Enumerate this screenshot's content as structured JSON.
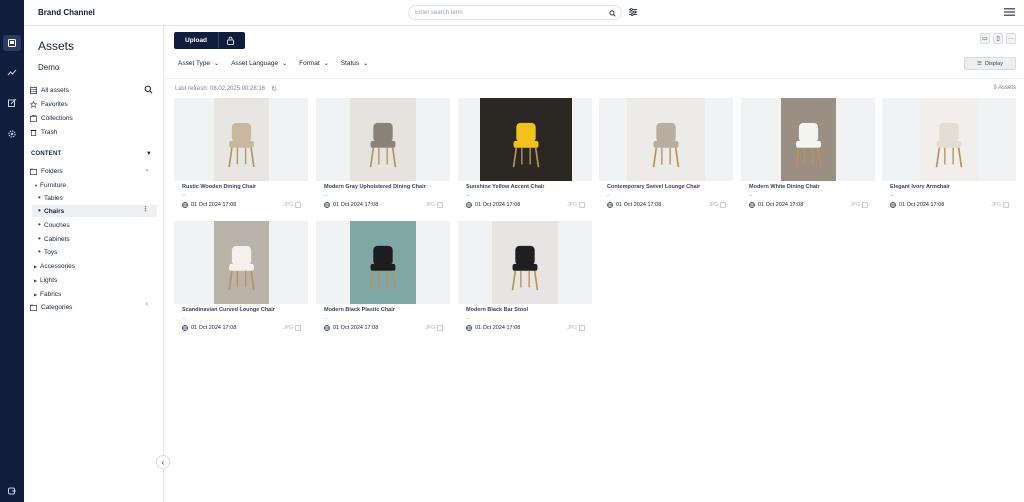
{
  "app": {
    "brand": "Brand Channel"
  },
  "search": {
    "placeholder": "Enter search term"
  },
  "sidebar": {
    "title": "Assets",
    "subtitle": "Demo",
    "nav": [
      {
        "label": "All assets",
        "icon": "grid-icon"
      },
      {
        "label": "Favorites",
        "icon": "star-icon"
      },
      {
        "label": "Collections",
        "icon": "folder-icon"
      },
      {
        "label": "Trash",
        "icon": "trash-icon"
      }
    ],
    "section_label": "CONTENT",
    "tree": {
      "folders": "Folders",
      "furniture": "Furniture",
      "tables": "Tables",
      "chairs": "Chairs",
      "couches": "Couches",
      "cabinets": "Cabinets",
      "toys": "Toys",
      "accessories": "Accessories",
      "lights": "Lights",
      "fabrics": "Fabrics",
      "categories": "Categories"
    }
  },
  "toolbar": {
    "upload_label": "Upload",
    "filters": [
      "Asset Type",
      "Asset Language",
      "Format",
      "Status"
    ],
    "display_label": "Display",
    "last_refresh": "Last refresh: 08.02.2025 00:28:16",
    "asset_count": "9 Assets"
  },
  "colors": {
    "primary": "#101d3d",
    "background": "#ffffff",
    "card_bg": "#f1f2f4"
  },
  "assets": [
    {
      "title": "Rustic Wooden Dining Chair",
      "dash": "--",
      "date": "01 Oct 2024 17:08",
      "format": "JPG",
      "image": {
        "bg": "#e8e6e2",
        "accent": "#c9b8a0"
      }
    },
    {
      "title": "Modern Gray Upholstered Dining Chair",
      "dash": "--",
      "date": "01 Oct 2024 17:08",
      "format": "JPG",
      "image": {
        "bg": "#e4e3de",
        "accent": "#8a8478"
      }
    },
    {
      "title": "Sunshine Yellow Accent Chair",
      "dash": "--",
      "date": "01 Oct 2024 17:08",
      "format": "JPG",
      "image": {
        "bg": "#2b2723",
        "accent": "#f2c21b"
      }
    },
    {
      "title": "Contemporary Swivel Lounge Chair",
      "dash": "--",
      "date": "01 Oct 2024 17:08",
      "format": "JPG",
      "image": {
        "bg": "#ecebe8",
        "accent": "#b8ada0"
      }
    },
    {
      "title": "Modern White Dining Chair",
      "dash": "--",
      "date": "01 Oct 2024 17:08",
      "format": "JPG",
      "image": {
        "bg": "#9a8f82",
        "accent": "#f4f4f2"
      }
    },
    {
      "title": "Elegant Ivory Armchair",
      "dash": "--",
      "date": "01 Oct 2024 17:08",
      "format": "JPG",
      "image": {
        "bg": "#f0efec",
        "accent": "#e4ddd2"
      }
    },
    {
      "title": "Scandinavian Curved Lounge Chair",
      "dash": "--",
      "date": "01 Oct 2024 17:08",
      "format": "JPG",
      "image": {
        "bg": "#b9b3aa",
        "accent": "#f2f1ee"
      }
    },
    {
      "title": "Modern Black Plastic Chair",
      "dash": "--",
      "date": "01 Oct 2024 17:08",
      "format": "JPG",
      "image": {
        "bg": "#7fa7a6",
        "accent": "#1d1d1f"
      }
    },
    {
      "title": "Modern Black Bar Stool",
      "dash": "--",
      "date": "01 Oct 2024 17:08",
      "format": "JPG",
      "image": {
        "bg": "#e6e5e3",
        "accent": "#1f1f21"
      }
    }
  ]
}
